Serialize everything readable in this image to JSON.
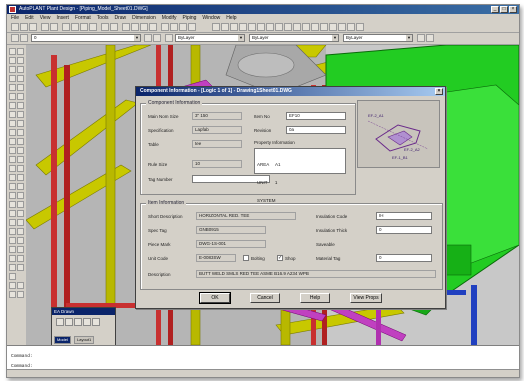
{
  "window": {
    "title": "AutoPLANT Plant Design - [Piping_Model_Sheet01.DWG]",
    "controls": [
      "_",
      "□",
      "×"
    ]
  },
  "menu": [
    "File",
    "Edit",
    "View",
    "Insert",
    "Format",
    "Tools",
    "Draw",
    "Dimension",
    "Modify",
    "Piping",
    "Window",
    "Help"
  ],
  "toolbar": {
    "layer_value": "0",
    "color_value": "ByLayer",
    "linetype_value": "ByLayer",
    "lineweight_value": "ByLayer"
  },
  "dialog": {
    "title": "Component Information - [Logic 1 of 1] - Drawing1Sheet01.DWG",
    "component_group": "Component Information",
    "fields": {
      "item_size_label": "Main Nom Size",
      "item_size_value": "3\" 150",
      "spec_label": "Specification",
      "spec_value": "Lapfab",
      "table_label": "Table",
      "table_value": "tee",
      "item_no_label": "Item No",
      "item_no_value": "EF10",
      "revision_label": "Revision",
      "revision_value": "0a",
      "rule_size_label": "Rule Size",
      "rule_size_value": "10",
      "tag_number_label": "Tag Number",
      "tag_number_value": "",
      "property_label": "Property Information",
      "property_lines": [
        "AREA     A1",
        "UNIT      1",
        "SYSTEM"
      ]
    },
    "item_group": "Item Information",
    "item": {
      "short_desc_label": "Short Description",
      "short_desc_value": "HORIZONTAL RED. TEE",
      "spec_tag_label": "Spec Tag",
      "spec_tag_value": "GNB0915",
      "piece_mark_label": "Piece Mark",
      "piece_mark_value": "DWG-1S-001",
      "unit_code_label": "Unit Code",
      "unit_code_value": "E-0083SW",
      "bolting_label": "Bolting",
      "shop_label": "Shop",
      "description_label": "Description",
      "description_value": "BUTT WELD SMLS RED TEE ASME B16.9 A234 WPB",
      "insulation_code_label": "Insulation Code",
      "insulation_code_value": "IH",
      "insulation_thick_label": "Insulation Thick",
      "insulation_thick_value": "0",
      "saveable_label": "Saveable",
      "material_tag_label": "Material Tag",
      "material_tag_value": "0"
    },
    "buttons": {
      "ok": "OK",
      "cancel": "Cancel",
      "help": "Help",
      "view_props": "View Props"
    },
    "preview_labels": [
      "EF-2_A1",
      "EF-2_A2",
      "EF-1_B1"
    ]
  },
  "palette": {
    "title": "EA Drawn",
    "tabs": [
      "Model",
      "Layout1"
    ]
  },
  "command": {
    "lines": [
      "Command:",
      "Command:"
    ]
  }
}
